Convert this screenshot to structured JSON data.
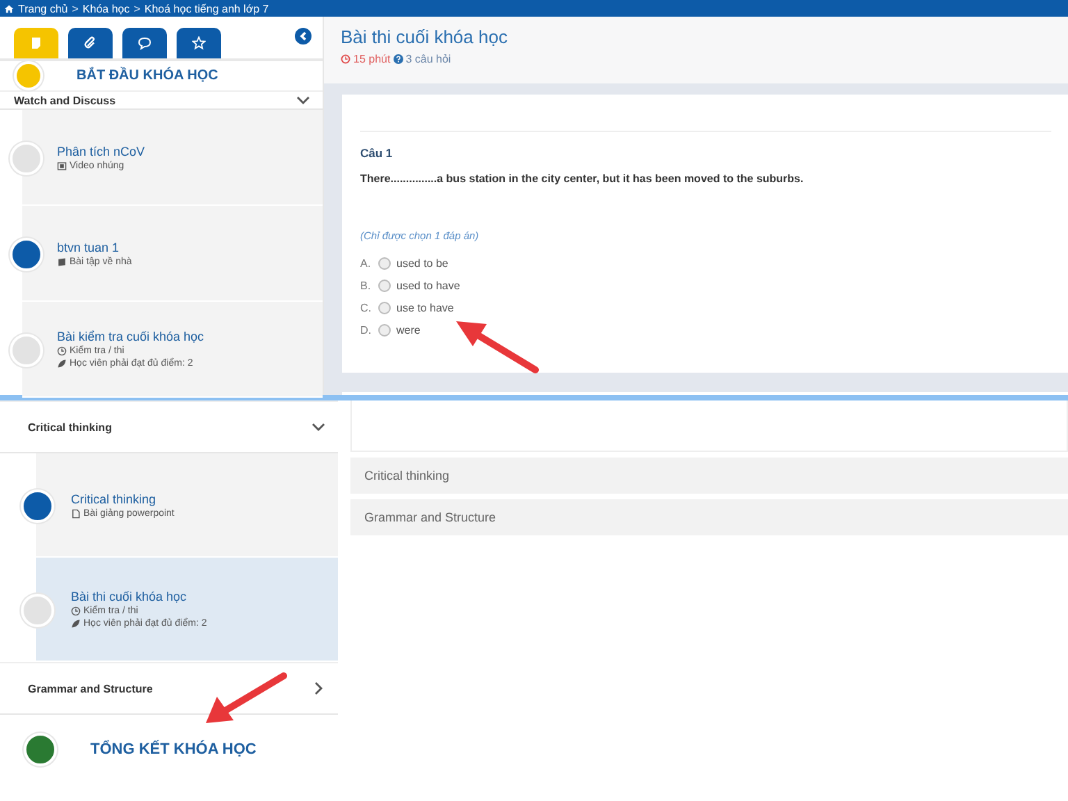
{
  "breadcrumb": {
    "items": [
      "Trang chủ",
      "Khóa học",
      "Khoá học tiếng anh lớp 7"
    ],
    "separator": ">"
  },
  "panels": [
    {
      "sidebar": {
        "tabs": [
          {
            "selected": true
          },
          {
            "selected": false
          },
          {
            "selected": false
          },
          {
            "selected": false
          }
        ],
        "items": [
          {
            "kind": "milestone",
            "title": "BẮT ĐẦU KHÓA HỌC",
            "color": "#f5c400"
          },
          {
            "kind": "section",
            "title": "Watch and Discuss",
            "expanded": true
          },
          {
            "kind": "lesson",
            "title": "Phân tích nCoV",
            "color": "#e3e3e3",
            "selected": false,
            "meta": [
              {
                "kind": "video",
                "text": "Video nhúng"
              }
            ]
          },
          {
            "kind": "lesson",
            "title": "btvn tuan 1",
            "color": "#0d5ba8",
            "selected": false,
            "meta": [
              {
                "kind": "homework",
                "text": "Bài tập về nhà"
              }
            ]
          },
          {
            "kind": "lesson",
            "title": "Bài kiểm tra cuối khóa học",
            "color": "#e3e3e3",
            "selected": false,
            "meta": [
              {
                "kind": "test",
                "text": "Kiểm tra / thi"
              },
              {
                "kind": "requirement",
                "text": "Học viên phải đạt đủ điểm: 2"
              }
            ]
          }
        ]
      },
      "content": {
        "kind": "quiz",
        "title": "Bài thi cuối khóa học",
        "duration": "15 phút",
        "count": "3 câu hỏi",
        "question": {
          "label": "Câu 1",
          "text": "There...............a bus station in the city center, but it has been moved to the suburbs.",
          "hint": "(Chỉ được chọn 1 đáp án)",
          "options": [
            {
              "letter": "A.",
              "text": "used to be",
              "selected": false
            },
            {
              "letter": "B.",
              "text": "used to have",
              "selected": false
            },
            {
              "letter": "C.",
              "text": "use to have",
              "selected": false
            },
            {
              "letter": "D.",
              "text": "were",
              "selected": false
            }
          ]
        }
      }
    },
    {
      "sidebar": {
        "items": [
          {
            "kind": "stub"
          },
          {
            "kind": "section",
            "title": "Critical thinking",
            "expanded": true
          },
          {
            "kind": "lesson",
            "title": "Critical thinking",
            "color": "#0d5ba8",
            "selected": false,
            "meta": [
              {
                "kind": "slides",
                "text": "Bài giảng powerpoint"
              }
            ]
          },
          {
            "kind": "lesson",
            "title": "Bài thi cuối khóa học",
            "color": "#e3e3e3",
            "selected": true,
            "meta": [
              {
                "kind": "test",
                "text": "Kiểm tra / thi"
              },
              {
                "kind": "requirement",
                "text": "Học viên phải đạt đủ điểm: 2"
              }
            ]
          },
          {
            "kind": "section",
            "title": "Grammar and Structure",
            "expanded": false
          },
          {
            "kind": "milestone",
            "title": "TỔNG KẾT KHÓA HỌC",
            "color": "#2a7a32"
          }
        ]
      },
      "content": {
        "kind": "sections",
        "sections": [
          "Critical thinking",
          "Grammar and Structure"
        ]
      }
    }
  ]
}
